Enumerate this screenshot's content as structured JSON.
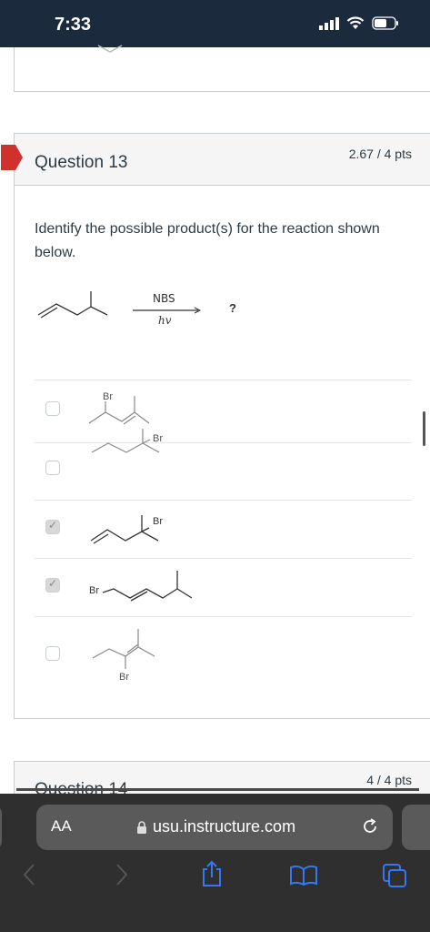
{
  "status_bar": {
    "time": "7:33"
  },
  "question": {
    "title": "Question 13",
    "points": "2.67 / 4 pts",
    "prompt": "Identify the possible product(s) for the reaction shown below.",
    "reaction": {
      "reagent_top": "NBS",
      "reagent_bottom": "hv",
      "product": "?"
    },
    "options": [
      {
        "label": "Br",
        "checked": false
      },
      {
        "label": "Br",
        "checked": false
      },
      {
        "label": "Br",
        "checked": true
      },
      {
        "label": "Br",
        "checked": true
      },
      {
        "label": "Br",
        "checked": false
      }
    ]
  },
  "next_question": {
    "title": "Question 14",
    "points": "4 / 4 pts"
  },
  "browser": {
    "text_size": "AA",
    "url": "usu.instructure.com"
  },
  "colors": {
    "status_bg": "#1b2a3d",
    "flag": "#d0312d",
    "safari_bg": "#2f2f2f",
    "url_bar": "#5a5a5a",
    "toolbar_blue": "#3478f6"
  }
}
